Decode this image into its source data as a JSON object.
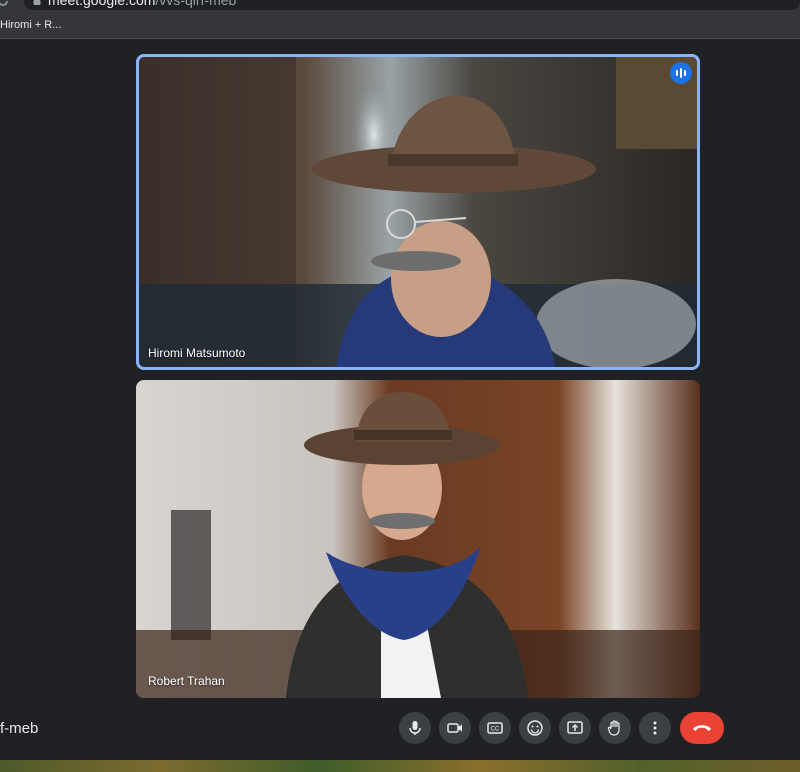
{
  "browser": {
    "url_host": "meet.google.com",
    "url_path": "/vvs-qirf-meb",
    "bookmark": "Hiromi + R..."
  },
  "tiles": [
    {
      "name": "Hiromi Matsumoto",
      "speaking": true
    },
    {
      "name": "Robert Trahan",
      "speaking": false
    }
  ],
  "meeting_code": "f-meb",
  "controls": [
    {
      "icon": "mic-icon"
    },
    {
      "icon": "camera-icon"
    },
    {
      "icon": "captions-icon"
    },
    {
      "icon": "emoji-icon"
    },
    {
      "icon": "present-screen-icon"
    },
    {
      "icon": "raise-hand-icon"
    },
    {
      "icon": "more-options-icon"
    },
    {
      "icon": "end-call-icon"
    }
  ],
  "colors": {
    "background": "#202124",
    "speaking_border": "#8ab4f8",
    "end_call": "#ea4335",
    "control_bg": "#3c4043"
  }
}
